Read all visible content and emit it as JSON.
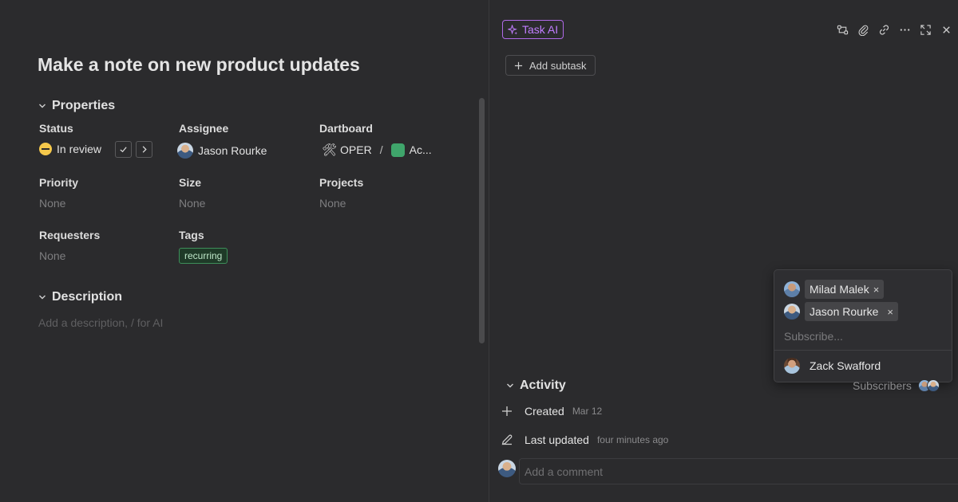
{
  "task": {
    "title": "Make a note on new product updates"
  },
  "properties": {
    "heading": "Properties",
    "status": {
      "label": "Status",
      "value": "In review"
    },
    "assignee": {
      "label": "Assignee",
      "value": "Jason Rourke"
    },
    "dartboard": {
      "label": "Dartboard",
      "space": "OPER",
      "separator": "/",
      "board": "Ac..."
    },
    "priority": {
      "label": "Priority",
      "value": "None"
    },
    "size": {
      "label": "Size",
      "value": "None"
    },
    "projects": {
      "label": "Projects",
      "value": "None"
    },
    "requesters": {
      "label": "Requesters",
      "value": "None"
    },
    "tags": {
      "label": "Tags",
      "value": "recurring"
    }
  },
  "description": {
    "heading": "Description",
    "placeholder": "Add a description, / for AI"
  },
  "toolbar": {
    "task_ai": "Task AI",
    "add_subtask": "Add subtask"
  },
  "subscribe_popover": {
    "selected": [
      {
        "name": "Milad Malek",
        "remove": "×"
      },
      {
        "name": "Jason Rourke",
        "remove": "×"
      }
    ],
    "placeholder": "Subscribe...",
    "options": [
      {
        "name": "Zack Swafford"
      }
    ]
  },
  "activity": {
    "heading": "Activity",
    "subscribers_label": "Subscribers",
    "events": [
      {
        "label": "Created",
        "time": "Mar 12",
        "icon": "plus-icon"
      },
      {
        "label": "Last updated",
        "time": "four minutes ago",
        "icon": "pencil-icon"
      }
    ],
    "comment_placeholder": "Add a comment"
  },
  "colors": {
    "background": "#2b2b2d",
    "status_in_review": "#f5c84b",
    "task_ai_accent": "#c17dff",
    "tag_recurring": "#3e8f5a"
  }
}
